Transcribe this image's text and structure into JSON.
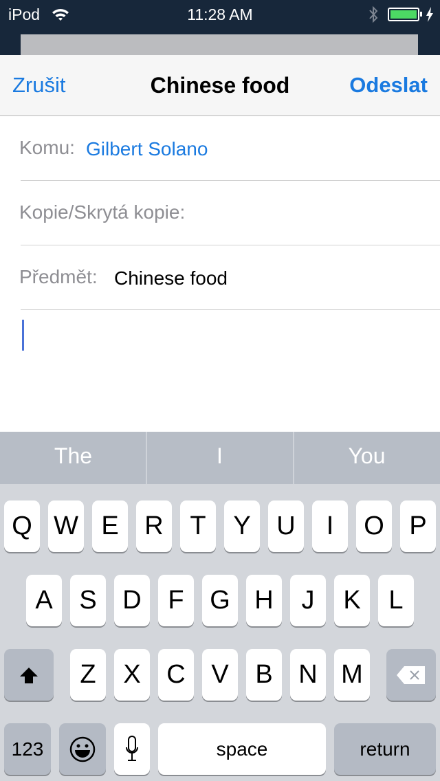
{
  "status_bar": {
    "device": "iPod",
    "time": "11:28 AM",
    "battery_level": 1.0,
    "battery_color": "#4cd964",
    "icons": [
      "wifi-icon",
      "bluetooth-icon",
      "battery-icon",
      "charging-icon"
    ]
  },
  "nav": {
    "cancel": "Zrušit",
    "title": "Chinese food",
    "send": "Odeslat",
    "accent": "#1a7ae0"
  },
  "fields": {
    "to_label": "Komu:",
    "to_value": "Gilbert Solano",
    "cc_label": "Kopie/Skrytá kopie:",
    "subject_label": "Předmět:",
    "subject_value": "Chinese food"
  },
  "suggestions": [
    "The",
    "I",
    "You"
  ],
  "keyboard": {
    "row1": [
      "Q",
      "W",
      "E",
      "R",
      "T",
      "Y",
      "U",
      "I",
      "O",
      "P"
    ],
    "row2": [
      "A",
      "S",
      "D",
      "F",
      "G",
      "H",
      "J",
      "K",
      "L"
    ],
    "row3": [
      "Z",
      "X",
      "C",
      "V",
      "B",
      "N",
      "M"
    ],
    "numbers": "123",
    "space": "space",
    "return": "return",
    "icons": [
      "shift-icon",
      "delete-icon",
      "emoji-icon",
      "microphone-icon"
    ]
  }
}
